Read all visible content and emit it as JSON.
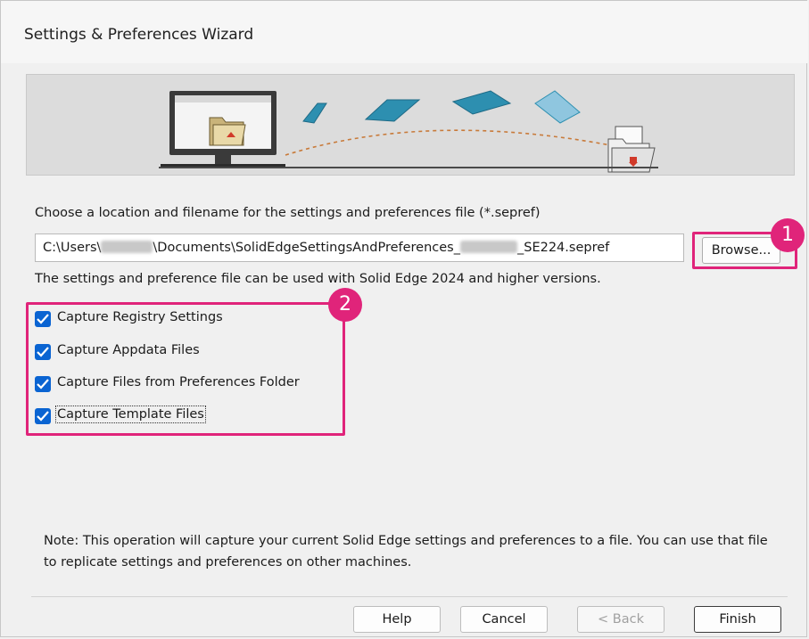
{
  "window": {
    "title": "Settings & Preferences Wizard"
  },
  "location": {
    "prompt": "Choose a location and filename for the settings and preferences file (*.sepref)",
    "path_prefix": "C:\\Users\\",
    "path_middle": "\\Documents\\SolidEdgeSettingsAndPreferences_",
    "path_suffix": "_SE224.sepref",
    "browse_label": "Browse...",
    "compat_note": "The settings and preference file can be used with Solid Edge 2024 and higher versions."
  },
  "options": [
    {
      "label": "Capture Registry Settings",
      "checked": true
    },
    {
      "label": "Capture Appdata Files",
      "checked": true
    },
    {
      "label": "Capture Files from Preferences Folder",
      "checked": true
    },
    {
      "label": "Capture Template Files",
      "checked": true
    }
  ],
  "annotations": {
    "badge1": "1",
    "badge2": "2",
    "color": "#e0247a"
  },
  "note": "Note: This operation will capture your current Solid Edge settings and preferences to a file. You can use that file to replicate settings and preferences on other machines.",
  "buttons": {
    "help": "Help",
    "cancel": "Cancel",
    "back": "< Back",
    "finish": "Finish"
  },
  "colors": {
    "checkbox": "#0a64d2",
    "banner": "#dcdcdc"
  }
}
